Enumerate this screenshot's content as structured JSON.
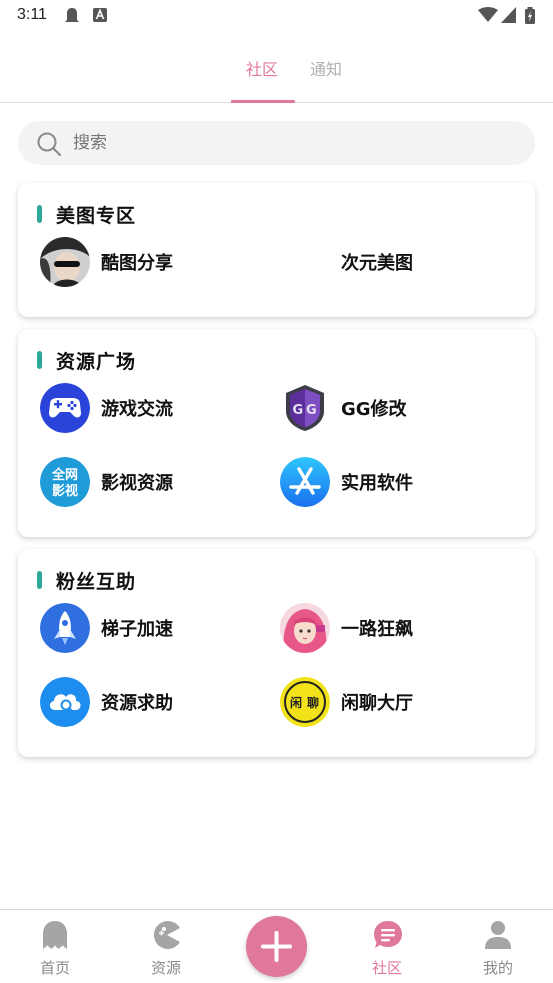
{
  "status_bar": {
    "time": "3:11"
  },
  "top_tabs": {
    "community": "社区",
    "notice": "通知"
  },
  "search": {
    "placeholder": "搜索"
  },
  "sections": [
    {
      "title": "美图专区",
      "items": [
        {
          "label": "酷图分享",
          "icon": "avatar-photo-icon"
        },
        {
          "label": "次元美图",
          "icon": "none"
        }
      ]
    },
    {
      "title": "资源广场",
      "items": [
        {
          "label": "游戏交流",
          "icon": "gamepad-icon"
        },
        {
          "label": "GG修改",
          "icon": "gg-guardian-icon"
        },
        {
          "label": "影视资源",
          "icon": "full-net-video-icon",
          "icon_text": [
            "全网",
            "影视"
          ]
        },
        {
          "label": "实用软件",
          "icon": "app-store-icon"
        }
      ]
    },
    {
      "title": "粉丝互助",
      "items": [
        {
          "label": "梯子加速",
          "icon": "rocket-icon"
        },
        {
          "label": "一路狂飙",
          "icon": "anime-avatar-icon"
        },
        {
          "label": "资源求助",
          "icon": "cloud-search-icon"
        },
        {
          "label": "闲聊大厅",
          "icon": "chat-hall-icon",
          "icon_text": [
            "闲",
            "聊"
          ]
        }
      ]
    }
  ],
  "bottom_nav": {
    "items": [
      {
        "label": "首页",
        "icon": "ghost-icon",
        "active": false
      },
      {
        "label": "资源",
        "icon": "pacman-icon",
        "active": false
      },
      {
        "label": "社区",
        "icon": "chat-bubble-icon",
        "active": true
      },
      {
        "label": "我的",
        "icon": "person-icon",
        "active": false
      }
    ],
    "fab_icon": "plus-icon"
  },
  "colors": {
    "accent": "#e0789c",
    "section_bar": "#2ea89a",
    "inactive": "#8a8a8a"
  }
}
